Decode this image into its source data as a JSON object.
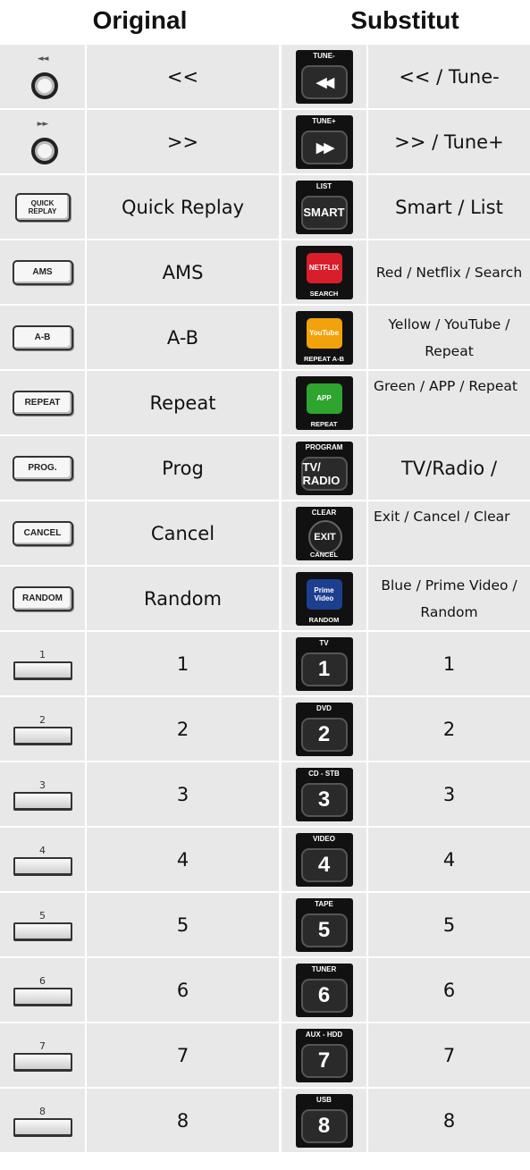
{
  "headers": {
    "original": "Original",
    "substitute": "Substitut"
  },
  "colors": {
    "cell_bg": "#e8e8e8",
    "netflix": "#d81e2a",
    "youtube": "#f2a20a",
    "app": "#2ea52e",
    "prime": "#1d3f8f"
  },
  "rows": [
    {
      "orig_icon": "rewind-knob-icon",
      "orig_icon_text": "◄◄",
      "orig_label": "<<",
      "sub_icon": "rewind-button-icon",
      "sub_top": "TUNE-",
      "sub_face": "◀◀",
      "sub_bottom": "",
      "sub_label": "<< / Tune-"
    },
    {
      "orig_icon": "fast-forward-knob-icon",
      "orig_icon_text": "►►",
      "orig_label": ">>",
      "sub_icon": "fast-forward-button-icon",
      "sub_top": "TUNE+",
      "sub_face": "▶▶",
      "sub_bottom": "",
      "sub_label": ">> / Tune+"
    },
    {
      "orig_icon": "quick-replay-button-icon",
      "orig_icon_text": "QUICK REPLAY",
      "orig_label": "Quick Replay",
      "sub_icon": "smart-button-icon",
      "sub_top": "LIST",
      "sub_face": "SMART",
      "sub_bottom": "",
      "sub_label": "Smart / List"
    },
    {
      "orig_icon": "ams-button-icon",
      "orig_icon_text": "AMS",
      "orig_label": "AMS",
      "sub_icon": "netflix-button-icon",
      "sub_top": "",
      "sub_face": "NETFLIX",
      "sub_bottom": "SEARCH",
      "sub_label": "Red / Netflix / Search"
    },
    {
      "orig_icon": "a-b-button-icon",
      "orig_icon_text": "A-B",
      "orig_label": "A-B",
      "sub_icon": "youtube-button-icon",
      "sub_top": "",
      "sub_face": "YouTube",
      "sub_bottom": "REPEAT A-B",
      "sub_label": "Yellow / YouTube / Repeat"
    },
    {
      "orig_icon": "repeat-button-icon",
      "orig_icon_text": "REPEAT",
      "orig_label": "Repeat",
      "sub_icon": "app-button-icon",
      "sub_top": "",
      "sub_face": "APP",
      "sub_bottom": "REPEAT",
      "sub_label": "Green / APP / Repeat"
    },
    {
      "orig_icon": "prog-button-icon",
      "orig_icon_text": "PROG.",
      "orig_label": "Prog",
      "sub_icon": "tv-radio-button-icon",
      "sub_top": "PROGRAM",
      "sub_face": "TV/ RADIO",
      "sub_bottom": "",
      "sub_label": "TV/Radio /"
    },
    {
      "orig_icon": "cancel-button-icon",
      "orig_icon_text": "CANCEL",
      "orig_label": "Cancel",
      "sub_icon": "exit-button-icon",
      "sub_top": "CLEAR",
      "sub_face": "EXIT",
      "sub_bottom": "CANCEL",
      "sub_label": "Exit / Cancel / Clear"
    },
    {
      "orig_icon": "random-button-icon",
      "orig_icon_text": "RANDOM",
      "orig_label": "Random",
      "sub_icon": "prime-video-button-icon",
      "sub_top": "",
      "sub_face": "Prime Video",
      "sub_bottom": "RANDOM",
      "sub_label": "Blue / Prime Video / Random"
    },
    {
      "orig_icon": "number-1-key-icon",
      "orig_icon_text": "1",
      "orig_label": "1",
      "sub_icon": "number-1-button-icon",
      "sub_top": "TV",
      "sub_face": "1",
      "sub_bottom": "",
      "sub_label": "1"
    },
    {
      "orig_icon": "number-2-key-icon",
      "orig_icon_text": "2",
      "orig_label": "2",
      "sub_icon": "number-2-button-icon",
      "sub_top": "DVD",
      "sub_face": "2",
      "sub_bottom": "",
      "sub_label": "2"
    },
    {
      "orig_icon": "number-3-key-icon",
      "orig_icon_text": "3",
      "orig_label": "3",
      "sub_icon": "number-3-button-icon",
      "sub_top": "CD - STB",
      "sub_face": "3",
      "sub_bottom": "",
      "sub_label": "3"
    },
    {
      "orig_icon": "number-4-key-icon",
      "orig_icon_text": "4",
      "orig_label": "4",
      "sub_icon": "number-4-button-icon",
      "sub_top": "VIDEO",
      "sub_face": "4",
      "sub_bottom": "",
      "sub_label": "4"
    },
    {
      "orig_icon": "number-5-key-icon",
      "orig_icon_text": "5",
      "orig_label": "5",
      "sub_icon": "number-5-button-icon",
      "sub_top": "TAPE",
      "sub_face": "5",
      "sub_bottom": "",
      "sub_label": "5"
    },
    {
      "orig_icon": "number-6-key-icon",
      "orig_icon_text": "6",
      "orig_label": "6",
      "sub_icon": "number-6-button-icon",
      "sub_top": "TUNER",
      "sub_face": "6",
      "sub_bottom": "",
      "sub_label": "6"
    },
    {
      "orig_icon": "number-7-key-icon",
      "orig_icon_text": "7",
      "orig_label": "7",
      "sub_icon": "number-7-button-icon",
      "sub_top": "AUX - HDD",
      "sub_face": "7",
      "sub_bottom": "",
      "sub_label": "7"
    },
    {
      "orig_icon": "number-8-key-icon",
      "orig_icon_text": "8",
      "orig_label": "8",
      "sub_icon": "number-8-button-icon",
      "sub_top": "USB",
      "sub_face": "8",
      "sub_bottom": "",
      "sub_label": "8"
    }
  ]
}
